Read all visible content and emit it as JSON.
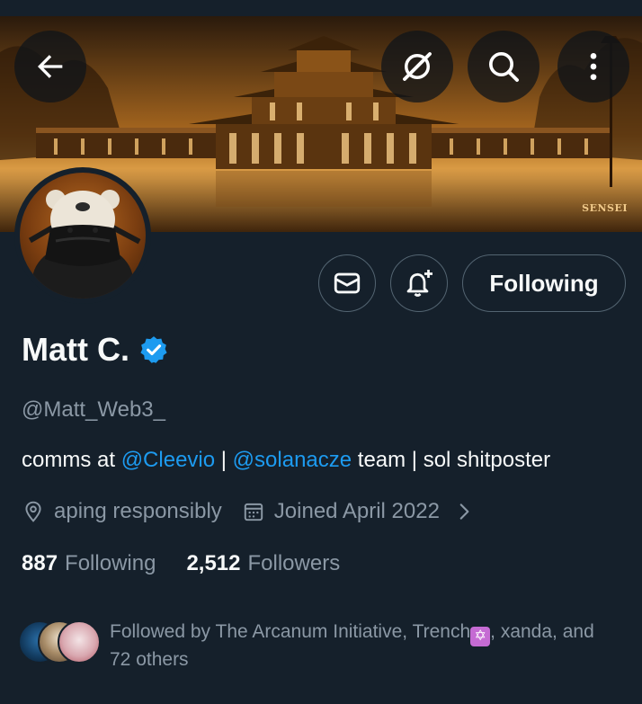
{
  "banner": {
    "tag_text": "SENSEI"
  },
  "top_actions": {
    "back_icon": "arrow-left-icon",
    "grok_icon": "grok-slash-icon",
    "search_icon": "search-icon",
    "more_icon": "more-vertical-icon"
  },
  "profile_actions": {
    "mail_icon": "envelope-icon",
    "notify_icon": "bell-plus-icon",
    "following_label": "Following"
  },
  "profile": {
    "name": "Matt C.",
    "handle": "@Matt_Web3_",
    "bio": {
      "prefix": "comms at ",
      "mention1": "@Cleevio",
      "separator": " | ",
      "mention2": "@solanacze",
      "suffix": " team | sol shitposter"
    },
    "location": "aping responsibly",
    "joined": "Joined April 2022",
    "following_count": "887",
    "following_label": "Following",
    "followers_count": "2,512",
    "followers_label": "Followers"
  },
  "followed_by": {
    "prefix": "Followed by The Arcanum Initiative, Trench",
    "badge_glyph": "✡",
    "suffix": ", xanda, and 72 others"
  },
  "colors": {
    "background": "#15202b",
    "accent": "#1d9bf0",
    "secondary_text": "#8b98a5",
    "border": "#536471"
  }
}
